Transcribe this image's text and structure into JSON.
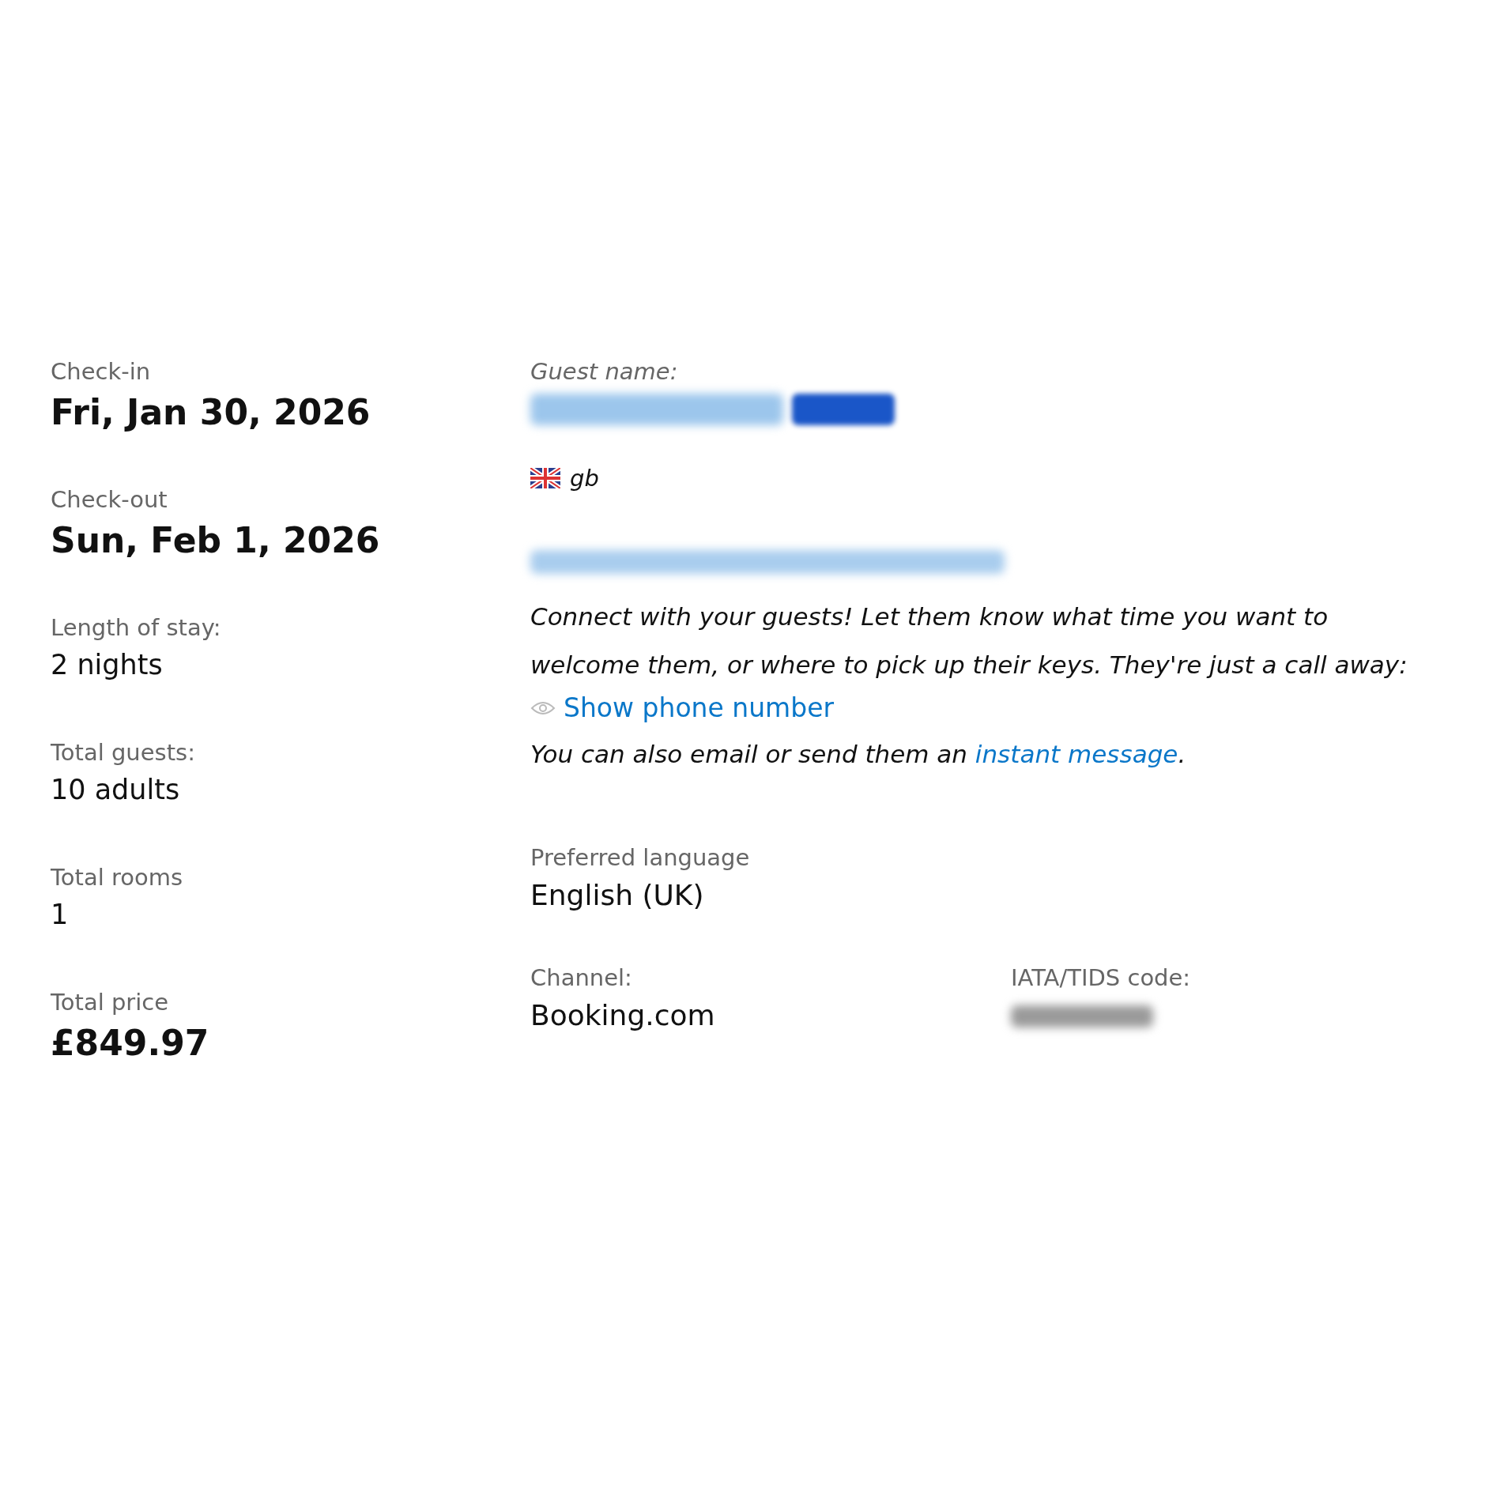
{
  "stay": [
    {
      "label": "Check-in",
      "value": "Fri, Jan 30, 2026",
      "kind": "big"
    },
    {
      "label": "Check-out",
      "value": "Sun, Feb 1, 2026",
      "kind": "big"
    },
    {
      "label": "Length of stay:",
      "value": "2 nights",
      "kind": "plain"
    },
    {
      "label": "Total guests:",
      "value": "10 adults",
      "kind": "plain"
    },
    {
      "label": "Total rooms",
      "value": "1",
      "kind": "plain"
    },
    {
      "label": "Total price",
      "value": "£849.97",
      "kind": "big"
    }
  ],
  "guest": {
    "label": "Guest name:",
    "name_redacted": true,
    "badge_redacted": true,
    "country": "gb",
    "email_redacted": true,
    "message": "Connect with your guests! Let them know what time you want to welcome them, or where to pick up their keys. They're just a call away:",
    "phone_link": "Show phone number",
    "also_text": "You can also email or send them an ",
    "also_link": "instant message",
    "also_end": ".",
    "language_label": "Preferred language",
    "language": "English (UK)",
    "channel_label": "Channel:",
    "channel": "Booking.com",
    "iata_label": "IATA/TIDS code:",
    "iata_redacted": true
  }
}
